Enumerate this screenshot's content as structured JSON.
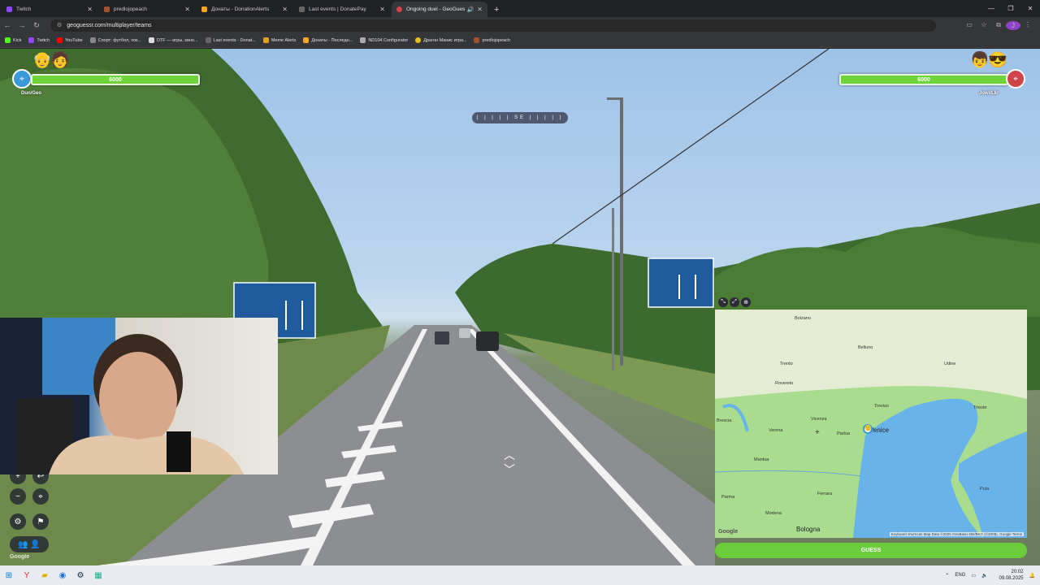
{
  "tabs": [
    {
      "title": "Twitch",
      "color": "#9146ff",
      "active": false
    },
    {
      "title": "predlojopeach",
      "color": "#a0522d",
      "active": false
    },
    {
      "title": "Донаты - DonationAlerts",
      "color": "#f5a623",
      "active": false
    },
    {
      "title": "Last events | DonatePay",
      "color": "#444",
      "active": false
    },
    {
      "title": "Ongoing duel - GeoGuessr",
      "color": "#d1434b",
      "active": true
    }
  ],
  "address": "geoguessr.com/multiplayer/teams",
  "bookmarks": [
    "Kick",
    "Twitch",
    "YouTube",
    "Спорт: футбол, хок...",
    "DTF — игры, кино...",
    "Last events - Donat...",
    "Meme Alerts",
    "Донаты - Последн...",
    "ND104 Configurator",
    "Драгон Манис игра...",
    "predlojopeach"
  ],
  "hud": {
    "left": {
      "health": "6000",
      "health_fraction": 1.0,
      "team": "Dun/Geo"
    },
    "right": {
      "health": "6000",
      "health_fraction": 1.0,
      "team": "Jowi/Lkr"
    }
  },
  "compass": {
    "heading": "SE"
  },
  "map": {
    "cities": [
      "Bolzano",
      "Trento",
      "Verona",
      "Vicenza",
      "Padua",
      "Venice",
      "Treviso",
      "Udine",
      "Trieste",
      "Mantua",
      "Ferrara",
      "Bologna",
      "Modena",
      "Parma",
      "Brescia",
      "Rovereto",
      "Belluno",
      "Pula"
    ],
    "attribution": "Keyboard shortcuts   Map Data ©2025 GeoBasis-DE/BKG (©2009), Google   Terms"
  },
  "guess_label": "GUESS",
  "google_label": "Google",
  "tray": {
    "lang": "ENG",
    "time": "20:02",
    "date": "09.08.2025"
  }
}
